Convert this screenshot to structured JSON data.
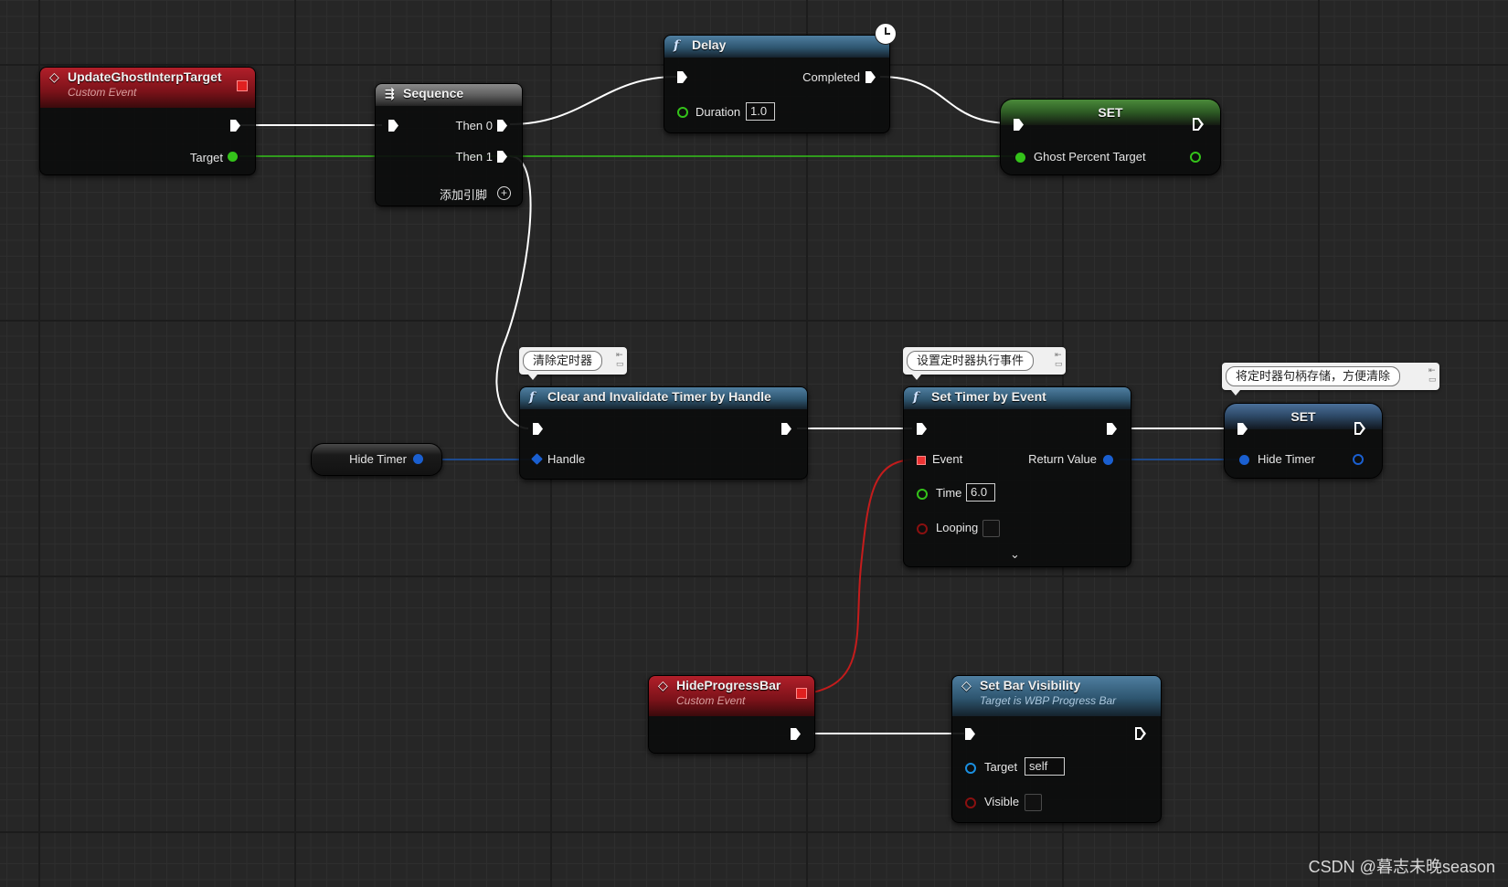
{
  "nodes": {
    "update_ghost": {
      "title": "UpdateGhostInterpTarget",
      "subtitle": "Custom Event",
      "pin_target": "Target"
    },
    "sequence": {
      "title": "Sequence",
      "then0": "Then 0",
      "then1": "Then 1",
      "add_pin": "添加引脚"
    },
    "delay": {
      "title": "Delay",
      "completed": "Completed",
      "duration_label": "Duration",
      "duration_value": "1.0"
    },
    "set_ghost": {
      "title": "SET",
      "pin_label": "Ghost Percent Target"
    },
    "hide_timer_get": {
      "label": "Hide Timer"
    },
    "clear_timer": {
      "title": "Clear and Invalidate Timer by Handle",
      "handle": "Handle",
      "comment": "清除定时器"
    },
    "set_timer": {
      "title": "Set Timer by Event",
      "event": "Event",
      "return_value": "Return Value",
      "time_label": "Time",
      "time_value": "6.0",
      "looping_label": "Looping",
      "comment": "设置定时器执行事件"
    },
    "set_hide_timer": {
      "title": "SET",
      "pin_label": "Hide Timer",
      "comment": "将定时器句柄存储，方便清除"
    },
    "hide_progress": {
      "title": "HideProgressBar",
      "subtitle": "Custom Event"
    },
    "set_bar_visibility": {
      "title": "Set Bar Visibility",
      "subtitle": "Target is WBP Progress Bar",
      "target_label": "Target",
      "target_value": "self",
      "visible_label": "Visible"
    }
  },
  "icons": {
    "function": "function-icon",
    "event": "event-diamond-icon",
    "sequence": "sequence-icon",
    "latent": "clock-icon",
    "add": "add-pin-icon",
    "expand": "chevron-down-icon"
  },
  "colors": {
    "exec_wire": "#ffffff",
    "float_pin": "#34c21a",
    "struct_pin": "#0a62d0",
    "delegate_pin": "#e02020",
    "bool_pin": "#8a1010",
    "object_pin": "#1a8fe0"
  },
  "watermark": "CSDN @暮志未晚season"
}
